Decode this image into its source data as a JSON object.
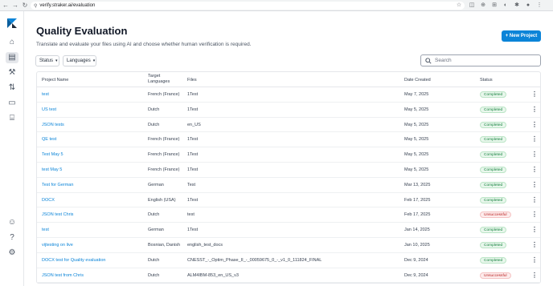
{
  "browser": {
    "url": "verify.straker.ai/evaluation"
  },
  "page": {
    "title": "Quality Evaluation",
    "subtitle": "Translate and evaluate your files using AI and choose whether human verification is required.",
    "new_project_label": "+ New Project",
    "filters": [
      {
        "label": "Status"
      },
      {
        "label": "Languages"
      }
    ],
    "search_placeholder": "Search"
  },
  "table": {
    "headers": {
      "name": "Project Name",
      "target_line1": "Target",
      "target_line2": "Languages",
      "files": "Files",
      "date": "Date Created",
      "status": "Status"
    },
    "rows": [
      {
        "name": "test",
        "languages": "French (France)",
        "files": "1Test",
        "date": "May 7, 2025",
        "status": "Completed"
      },
      {
        "name": "US test",
        "languages": "Dutch",
        "files": "1Test",
        "date": "May 5, 2025",
        "status": "Completed"
      },
      {
        "name": "JSON tests",
        "languages": "Dutch",
        "files": "en_US",
        "date": "May 5, 2025",
        "status": "Completed"
      },
      {
        "name": "QE test",
        "languages": "French (France)",
        "files": "1Test",
        "date": "May 5, 2025",
        "status": "Completed"
      },
      {
        "name": "Test May 5",
        "languages": "French (France)",
        "files": "1Test",
        "date": "May 5, 2025",
        "status": "Completed"
      },
      {
        "name": "test May 5",
        "languages": "French (France)",
        "files": "1Test",
        "date": "May 5, 2025",
        "status": "Completed"
      },
      {
        "name": "Test for German",
        "languages": "German",
        "files": "Test",
        "date": "Mar 13, 2025",
        "status": "Completed"
      },
      {
        "name": "DOCX",
        "languages": "English (USA)",
        "files": "1Test",
        "date": "Feb 17, 2025",
        "status": "Completed"
      },
      {
        "name": "JSON test Chris",
        "languages": "Dutch",
        "files": "test",
        "date": "Feb 17, 2025",
        "status": "Unsuccessful"
      },
      {
        "name": "test",
        "languages": "German",
        "files": "1Test",
        "date": "Jan 14, 2025",
        "status": "Completed"
      },
      {
        "name": "vijtesting on live",
        "languages": "Bosnian, Danish",
        "files": "english_test_docs",
        "date": "Jan 10, 2025",
        "status": "Completed"
      },
      {
        "name": "DOCX test for Quality evaluation",
        "languages": "Dutch",
        "files": "CNESST_-_Optim_Phase_II_-_00059675_0_-_v1_0_111824_FINAL",
        "date": "Dec 9, 2024",
        "status": "Completed"
      },
      {
        "name": "JSON test from Chris",
        "languages": "Dutch",
        "files": "ALM4IBM-853_en_US_v3",
        "date": "Dec 9, 2024",
        "status": "Unsuccessful"
      }
    ]
  },
  "colors": {
    "accent": "#0b84d8",
    "completed": "#15803d",
    "unsuccessful": "#b91c1c"
  }
}
